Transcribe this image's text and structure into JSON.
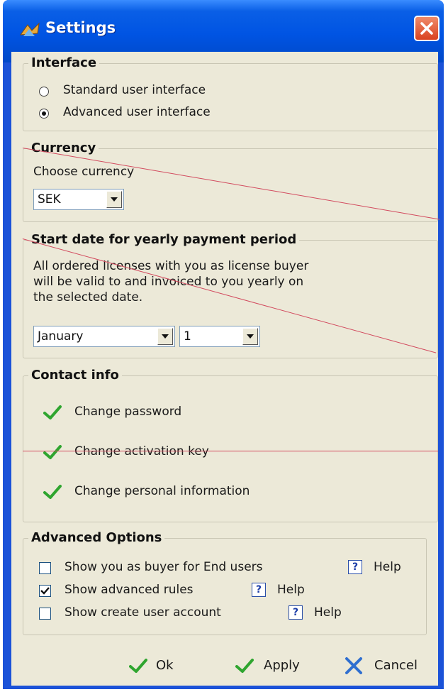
{
  "window": {
    "title": "Settings"
  },
  "interface": {
    "legend": "Interface",
    "options": [
      {
        "label": "Standard user interface",
        "checked": false
      },
      {
        "label": "Advanced user interface",
        "checked": true
      }
    ]
  },
  "currency": {
    "legend": "Currency",
    "prompt": "Choose currency",
    "selected": "SEK"
  },
  "start_date": {
    "legend": "Start date for yearly payment period",
    "desc_lines": [
      "All ordered licenses with you as license buyer",
      "will be valid to and invoiced to you yearly on",
      "the selected date."
    ],
    "month": "January",
    "day": "1"
  },
  "contact": {
    "legend": "Contact info",
    "links": [
      "Change password",
      "Change activation key",
      "Change personal information"
    ]
  },
  "advanced": {
    "legend": "Advanced Options",
    "help_label": "Help",
    "help_glyph": "?",
    "options": [
      {
        "label": "Show you as buyer for End users",
        "checked": false
      },
      {
        "label": "Show advanced rules",
        "checked": true
      },
      {
        "label": "Show create user account",
        "checked": false
      }
    ]
  },
  "buttons": {
    "ok": "Ok",
    "apply": "Apply",
    "cancel": "Cancel"
  },
  "colors": {
    "title_blue": "#0054e3",
    "panel": "#ece9d8",
    "check_green": "#2fa52f",
    "close_red": "#d9421f",
    "annotation_line": "#d24a5e"
  }
}
